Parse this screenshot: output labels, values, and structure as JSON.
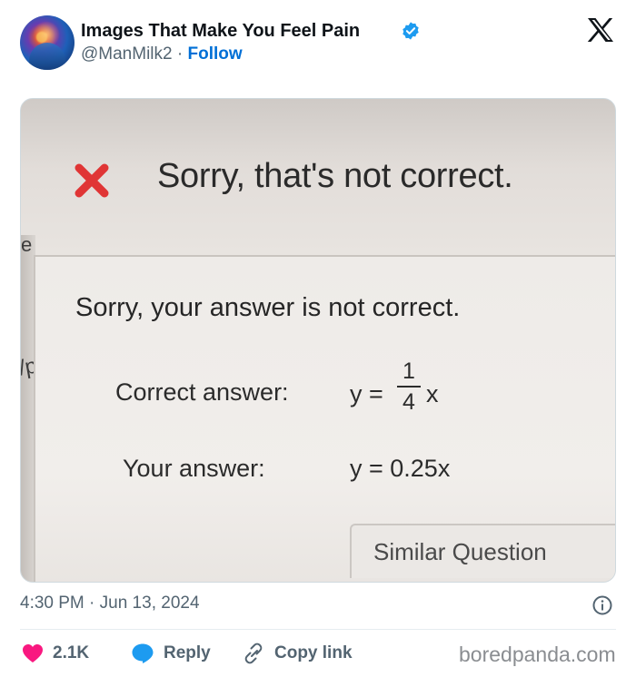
{
  "author": {
    "name": "Images That Make You Feel Pain",
    "handle": "@ManMilk2",
    "separator": "·",
    "follow_label": "Follow",
    "verified_icon": "verified-badge-icon",
    "avatar_icon": "avatar"
  },
  "platform_icon": "x-logo-icon",
  "photo": {
    "header_text": "Sorry, that's not correct.",
    "body_text": "Sorry, your answer is not correct.",
    "correct_label": "Correct answer:",
    "correct_eq_prefix": "y =",
    "correct_frac_num": "1",
    "correct_frac_den": "4",
    "correct_eq_suffix": "x",
    "your_label": "Your answer:",
    "your_eq": "y = 0.25x",
    "similar_button": "Similar Question",
    "side_char_top": "e",
    "side_char_mid": "/p",
    "x_mark_icon": "red-x-icon",
    "x_mark_color": "#e03535"
  },
  "timestamp": "4:30 PM · Jun 13, 2024",
  "actions": {
    "like_count": "2.1K",
    "reply_label": "Reply",
    "copy_label": "Copy link"
  },
  "watermark": "boredpanda.com",
  "colors": {
    "accent": "#006fd6",
    "heart": "#f91880",
    "reply": "#1d9bf0",
    "muted": "#536471"
  }
}
